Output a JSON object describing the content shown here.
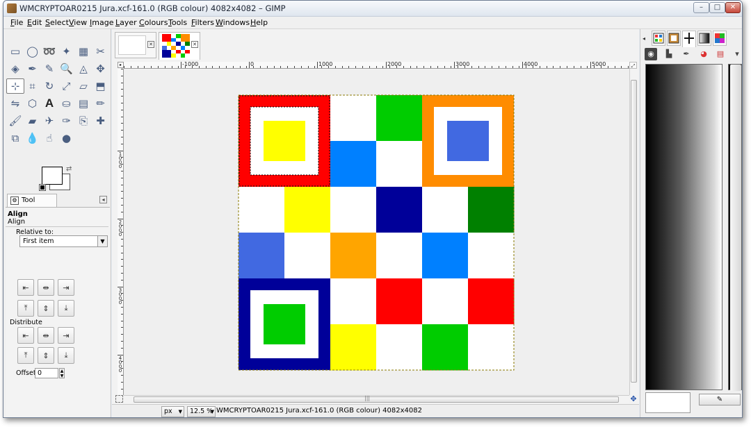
{
  "window": {
    "title": "WMCRYPTOAR0215 Jura.xcf-161.0 (RGB colour) 4082x4082 – GIMP",
    "controls": {
      "minimize": "–",
      "maximize": "□",
      "close": "✕"
    }
  },
  "menubar": {
    "items": [
      "File",
      "Edit",
      "Select",
      "View",
      "Image",
      "Layer",
      "Colours",
      "Tools",
      "Filters",
      "Windows",
      "Help"
    ]
  },
  "toolbox": {
    "tools": [
      {
        "name": "rect-select",
        "glyph": "▭"
      },
      {
        "name": "ellipse-select",
        "glyph": "◯"
      },
      {
        "name": "free-select",
        "glyph": "➿"
      },
      {
        "name": "fuzzy-select",
        "glyph": "✦"
      },
      {
        "name": "select-by-colour",
        "glyph": "▦"
      },
      {
        "name": "scissors",
        "glyph": "✂"
      },
      {
        "name": "foreground-select",
        "glyph": "◈"
      },
      {
        "name": "paths",
        "glyph": "✒"
      },
      {
        "name": "colour-picker",
        "glyph": "✎"
      },
      {
        "name": "zoom",
        "glyph": "🔍"
      },
      {
        "name": "measure",
        "glyph": "◬"
      },
      {
        "name": "move",
        "glyph": "✥"
      },
      {
        "name": "align",
        "glyph": "⊹"
      },
      {
        "name": "crop",
        "glyph": "⌗"
      },
      {
        "name": "rotate",
        "glyph": "↻"
      },
      {
        "name": "scale",
        "glyph": "⤢"
      },
      {
        "name": "shear",
        "glyph": "▱"
      },
      {
        "name": "perspective",
        "glyph": "⬒"
      },
      {
        "name": "flip",
        "glyph": "⇋"
      },
      {
        "name": "cage",
        "glyph": "⬡"
      },
      {
        "name": "text",
        "glyph": "A"
      },
      {
        "name": "bucket-fill",
        "glyph": "⛀"
      },
      {
        "name": "blend",
        "glyph": "▤"
      },
      {
        "name": "pencil",
        "glyph": "✏"
      },
      {
        "name": "paintbrush",
        "glyph": "🖌"
      },
      {
        "name": "eraser",
        "glyph": "▰"
      },
      {
        "name": "airbrush",
        "glyph": "✈"
      },
      {
        "name": "ink",
        "glyph": "✑"
      },
      {
        "name": "clone",
        "glyph": "⎘"
      },
      {
        "name": "heal",
        "glyph": "✚"
      },
      {
        "name": "perspective-clone",
        "glyph": "⧉"
      },
      {
        "name": "blur",
        "glyph": "💧"
      },
      {
        "name": "smudge",
        "glyph": "☝"
      },
      {
        "name": "dodge-burn",
        "glyph": "●"
      }
    ],
    "active_tool": "align"
  },
  "tool_options": {
    "tab_label": "Tool Options",
    "title": "Align",
    "subtitle": "Align",
    "relative_to_label": "Relative to:",
    "relative_to_value": "First item",
    "distribute_label": "Distribute",
    "offset_label": "Offset:",
    "offset_value": "0",
    "align_buttons": [
      "align-left",
      "align-hcenter",
      "align-right",
      "align-top",
      "align-vcenter",
      "align-bottom"
    ],
    "distribute_buttons": [
      "distribute-left",
      "distribute-hcenter",
      "distribute-right",
      "distribute-top",
      "distribute-vcenter",
      "distribute-bottom"
    ]
  },
  "image_tabs": [
    {
      "name": "untitled-image",
      "active": false
    },
    {
      "name": "jura-image",
      "active": true
    }
  ],
  "ruler": {
    "h_labels": [
      "-1000",
      "0",
      "1000",
      "2000",
      "3000",
      "4000",
      "5000"
    ],
    "v_labels": [
      "1000",
      "2000",
      "3000",
      "4000"
    ]
  },
  "canvas": {
    "colors": {
      "red": "#ff0000",
      "yellow": "#ffff00",
      "green": "#00cc00",
      "dark_green": "#008000",
      "blue": "#0080ff",
      "royal": "#4169e1",
      "navy": "#000099",
      "orange": "#ff8c00",
      "orange_light": "#ffa500",
      "white": "#ffffff"
    },
    "grid": [
      [
        "frame-red",
        "frame-red",
        "white",
        "green",
        "frame-orange",
        "frame-orange"
      ],
      [
        "frame-red",
        "frame-red",
        "blue",
        "white",
        "frame-orange",
        "frame-orange"
      ],
      [
        "white",
        "yellow",
        "white",
        "navy",
        "white",
        "dark_green"
      ],
      [
        "royal",
        "white",
        "orange_light",
        "white",
        "blue",
        "white"
      ],
      [
        "frame-navy",
        "frame-navy",
        "white",
        "red",
        "white",
        "red"
      ],
      [
        "frame-navy",
        "frame-navy",
        "yellow",
        "white",
        "green",
        "white"
      ]
    ]
  },
  "statusbar": {
    "unit": "px",
    "zoom": "12.5 %",
    "text": "WMCRYPTOAR0215 Jura.xcf-161.0 (RGB colour) 4082x4082"
  },
  "right_dock": {
    "tabs": [
      "patterns",
      "brushes-active",
      "gradient-active",
      "gradients",
      "palettes"
    ],
    "toolbar_icons": [
      "layers",
      "channels",
      "paths",
      "colours",
      "undo",
      "more"
    ]
  }
}
